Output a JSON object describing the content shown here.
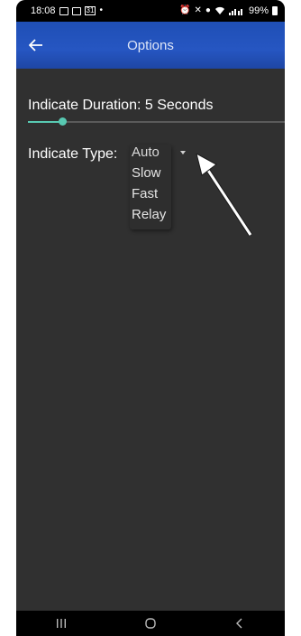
{
  "status_bar": {
    "time": "18:08",
    "date_icon_text": "31",
    "battery": "99%"
  },
  "app_bar": {
    "title": "Options",
    "back_icon": "arrow-left-icon"
  },
  "duration": {
    "label": "Indicate Duration: 5 Seconds",
    "slider_fraction": 0.13,
    "accent_color": "#58c9b2"
  },
  "indicate_type": {
    "label": "Indicate Type:",
    "selected": "Auto",
    "options": [
      "Auto",
      "Slow",
      "Fast",
      "Relay"
    ]
  },
  "colors": {
    "background": "#303030",
    "app_bar": "#2656c2"
  }
}
